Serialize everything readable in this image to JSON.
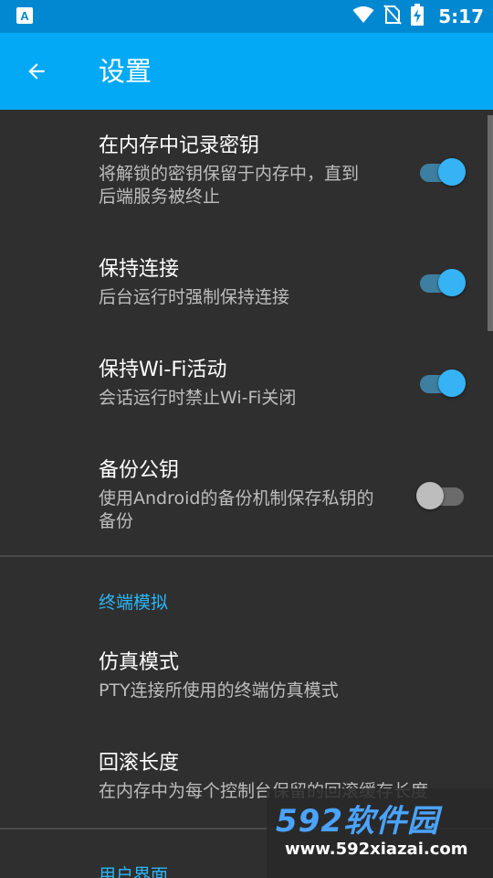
{
  "status_bar": {
    "time": "5:17",
    "icons": [
      "app-notification-icon",
      "wifi-icon",
      "no-sim-icon",
      "battery-charging-icon"
    ]
  },
  "app_bar": {
    "title": "设置",
    "back_icon": "arrow-back-icon"
  },
  "preferences": [
    {
      "title": "在内存中记录密钥",
      "summary": "将解锁的密钥保留于内存中，直到后端服务被终止",
      "enabled": true
    },
    {
      "title": "保持连接",
      "summary": "后台运行时强制保持连接",
      "enabled": true
    },
    {
      "title": "保持Wi-Fi活动",
      "summary": "会话运行时禁止Wi-Fi关闭",
      "enabled": true
    },
    {
      "title": "备份公钥",
      "summary": "使用Android的备份机制保存私钥的备份",
      "enabled": false
    }
  ],
  "terminal_category": {
    "title": "终端模拟",
    "items": [
      {
        "title": "仿真模式",
        "summary": "PTY连接所使用的终端仿真模式"
      },
      {
        "title": "回滚长度",
        "summary": "在内存中为每个控制台保留的回滚缓存长度"
      }
    ]
  },
  "ui_category": {
    "title": "用户界面"
  },
  "watermark": {
    "logo": "592软件园",
    "url": "www.592xiazai.com"
  },
  "colors": {
    "status_bar": "#0288d1",
    "app_bar": "#03a9f4",
    "background": "#2f2f2f",
    "accent": "#29b6f6"
  }
}
